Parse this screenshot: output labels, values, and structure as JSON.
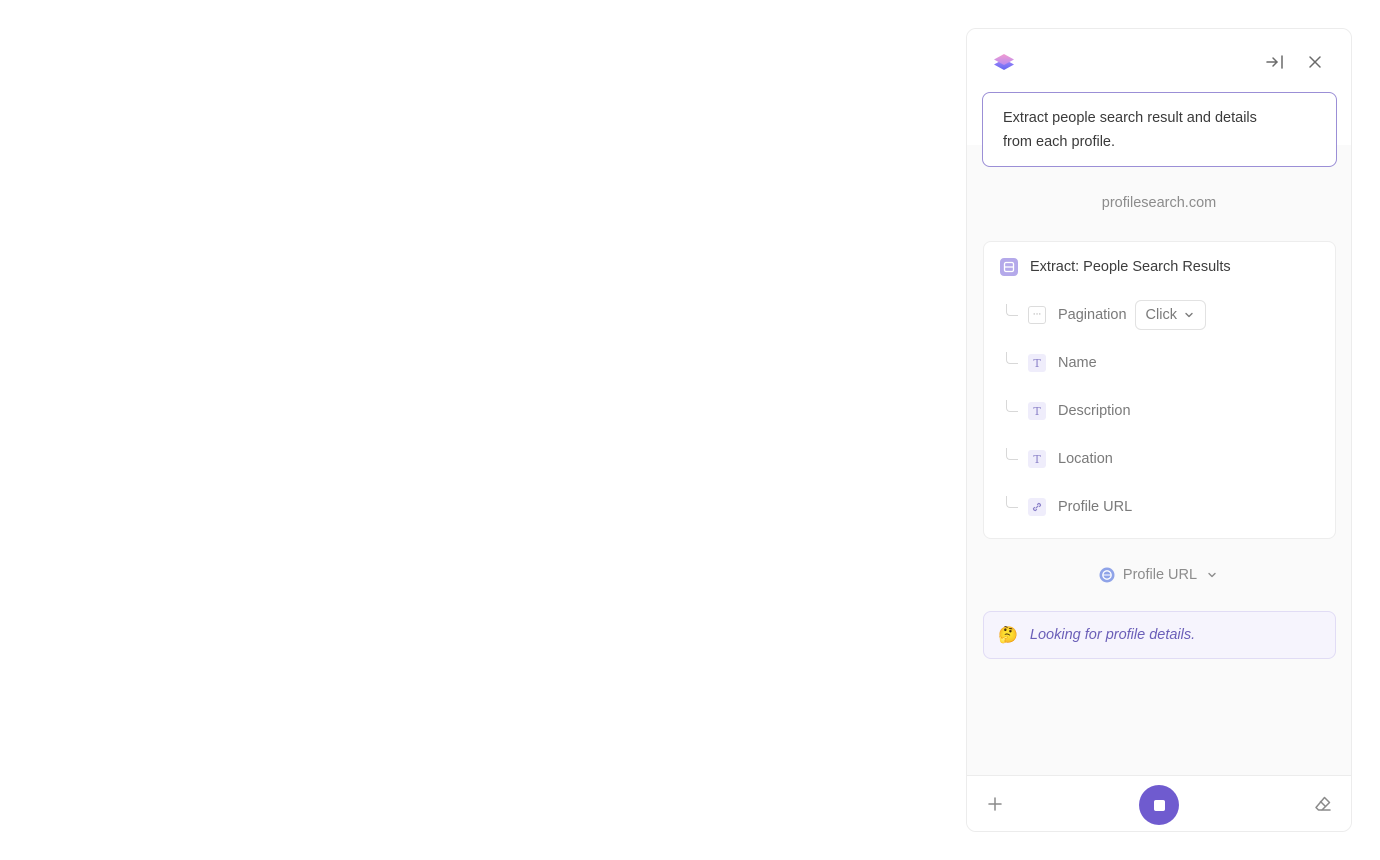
{
  "header": {
    "logo_icon": "layers-logo",
    "collapse_icon": "collapse-right-icon",
    "close_icon": "close-icon"
  },
  "prompt": {
    "text": "Extract people search result and details from each profile."
  },
  "site": {
    "label": "profilesearch.com"
  },
  "extract": {
    "title": "Extract: People Search Results",
    "pagination": {
      "label": "Pagination",
      "value": "Click"
    },
    "fields": [
      {
        "label": "Name",
        "icon": "text-icon"
      },
      {
        "label": "Description",
        "icon": "text-icon"
      },
      {
        "label": "Location",
        "icon": "text-icon"
      },
      {
        "label": "Profile URL",
        "icon": "link-icon"
      }
    ]
  },
  "navigate": {
    "label": "Profile URL",
    "icon": "globe-icon"
  },
  "status": {
    "emoji": "🤔",
    "text": "Looking for profile details."
  },
  "footer": {
    "add_icon": "plus-icon",
    "stop_icon": "stop-icon",
    "eraser_icon": "eraser-icon"
  },
  "colors": {
    "accent": "#6f5bcf",
    "prompt_border": "#9b8fd6",
    "status_bg": "#f6f4fd",
    "status_text": "#6b5fb8"
  }
}
